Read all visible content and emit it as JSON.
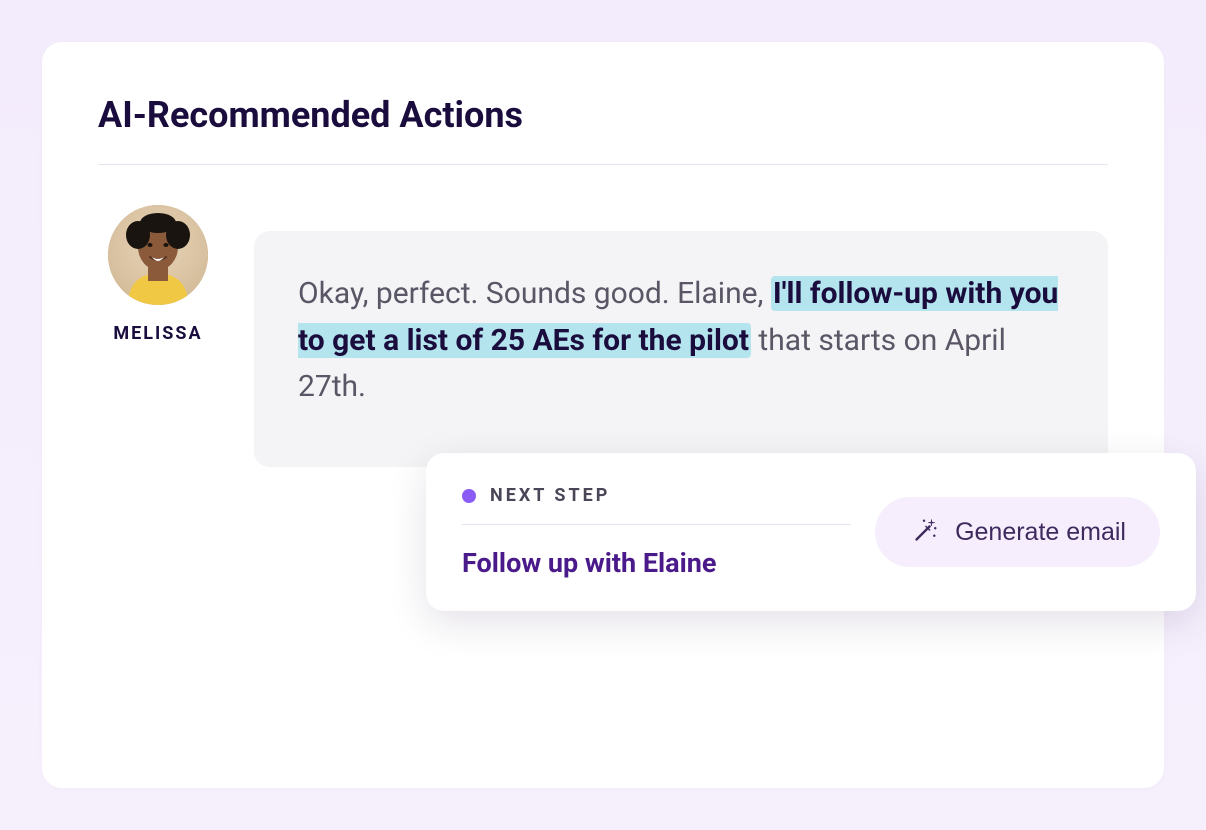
{
  "header": {
    "title": "AI-Recommended Actions"
  },
  "speaker": {
    "name": "MELISSA"
  },
  "message": {
    "pre": "Okay, perfect. Sounds good. Elaine, ",
    "highlight": "I'll follow-up with you to get a list of 25 AEs for the pilot",
    "post": " that starts on April 27th."
  },
  "action": {
    "label": "NEXT STEP",
    "title": "Follow up with Elaine",
    "button_label": "Generate email"
  }
}
